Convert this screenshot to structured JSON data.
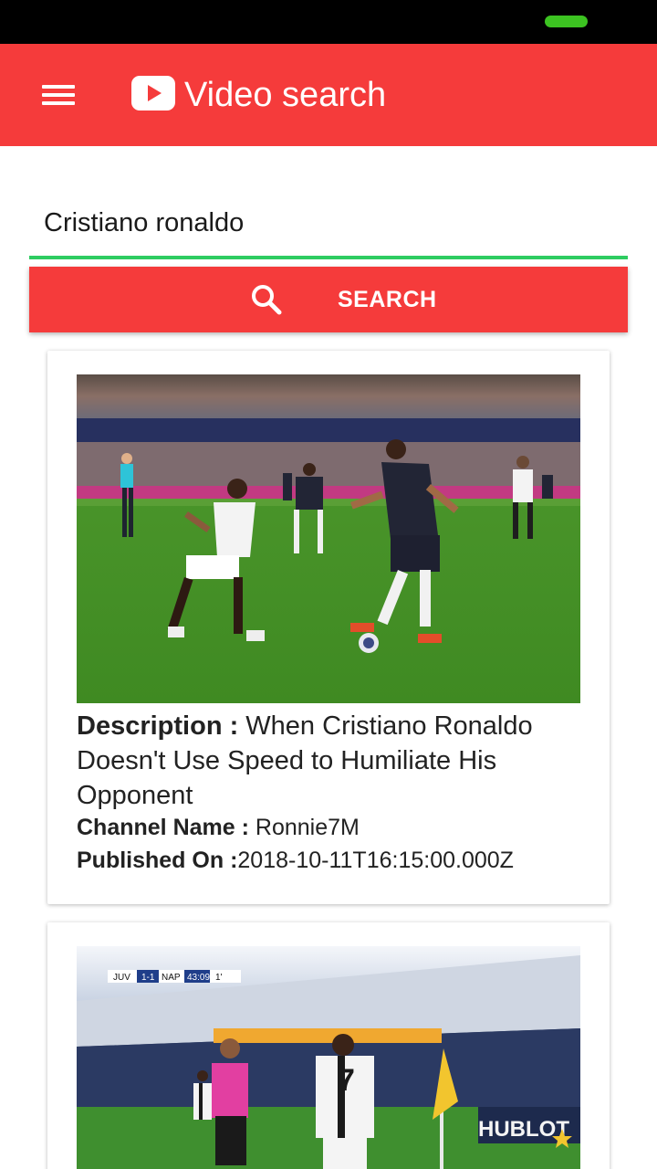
{
  "app": {
    "title": "Video search",
    "brand_color": "#f53b3b",
    "accent_color": "#2ecc61"
  },
  "header": {
    "menu_icon": "hamburger-menu-icon",
    "logo_icon": "youtube-play-icon"
  },
  "search": {
    "value": "Cristiano ronaldo",
    "button_label": "SEARCH",
    "button_icon": "search-icon"
  },
  "results": [
    {
      "description_label": "Description :",
      "description": " When Cristiano Ronaldo Doesn't Use Speed to Humiliate His Opponent",
      "channel_label": "Channel Name :",
      "channel": " Ronnie7M",
      "published_label": "Published On :",
      "published": "2018-10-11T16:15:00.000Z"
    },
    {
      "scoreboard": {
        "home": "JUV",
        "score": "1-1",
        "away": "NAP",
        "clock": "43:09",
        "half": "1'"
      },
      "banner_text": "HUBLOT"
    }
  ]
}
